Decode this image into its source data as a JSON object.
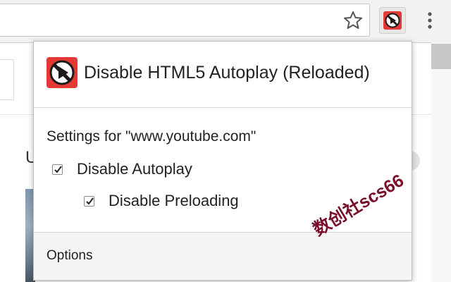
{
  "toolbar": {
    "star_icon": "star-icon",
    "extension_icon": "no-autoplay-icon",
    "menu_icon": "vertical-dots-icon",
    "extension_color": "#e53935"
  },
  "page": {
    "heading_fragment": "U"
  },
  "popup": {
    "title": "Disable HTML5 Autoplay (Reloaded)",
    "settings_label": "Settings for \"www.youtube.com\"",
    "options": [
      {
        "label": "Disable Autoplay",
        "checked": true
      },
      {
        "label": "Disable Preloading",
        "checked": true
      }
    ],
    "footer_link": "Options"
  },
  "watermark": {
    "text": "数创社scs66",
    "color": "#7a0f2a"
  }
}
